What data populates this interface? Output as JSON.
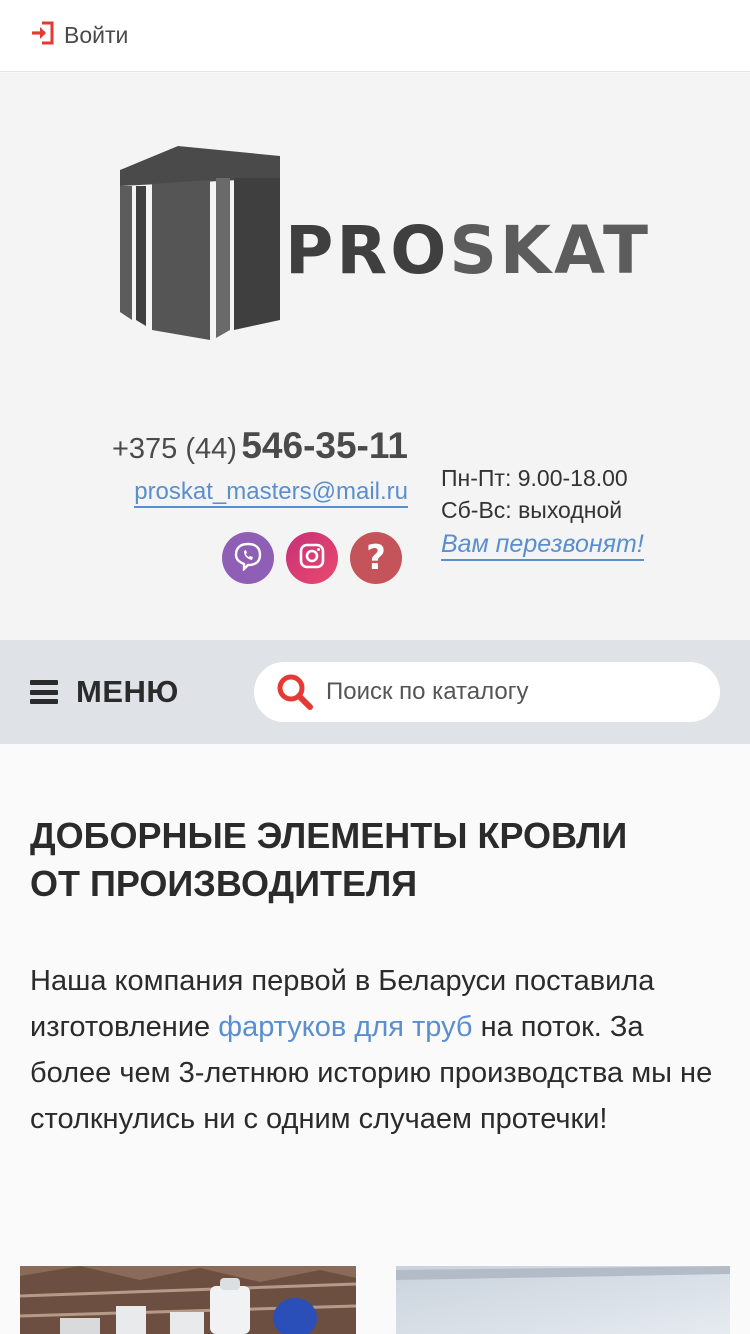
{
  "topbar": {
    "login_label": "Войти",
    "login_icon": "login-icon"
  },
  "header": {
    "logo": {
      "pro": "PRO",
      "skat": "SKAT"
    },
    "phone": {
      "code": "+375 (44)",
      "number": "546-35-11"
    },
    "email": "proskat_masters@mail.ru",
    "social": [
      "viber-icon",
      "instagram-icon",
      "help-icon"
    ],
    "hours": {
      "weekdays": "Пн-Пт: 9.00-18.00",
      "weekend": "Сб-Вс: выходной"
    },
    "callback": "Вам перезвонят!"
  },
  "menubar": {
    "menu_label": "МЕНЮ",
    "search_placeholder": "Поиск по каталогу"
  },
  "main": {
    "heading_line1": "ДОБОРНЫЕ ЭЛЕМЕНТЫ КРОВЛИ",
    "heading_line2": "ОТ ПРОИЗВОДИТЕЛЯ",
    "intro_before": "Наша компания первой в Беларуси поставила изготовление ",
    "intro_link": "фартуков для труб",
    "intro_after": " на поток. За более чем 3-летнюю историю производства мы не столкнулись ни с одним случаем протечки!"
  },
  "colors": {
    "accent_link": "#5a8fcf",
    "login_icon": "#e53935",
    "search_icon": "#e53935",
    "menubar_bg": "#dfe2e6"
  }
}
